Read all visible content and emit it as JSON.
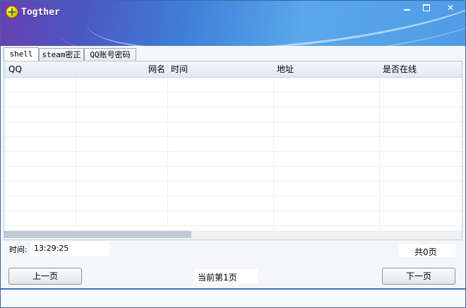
{
  "window": {
    "title": "Togther",
    "icon": "app-plus-icon"
  },
  "tabs": [
    {
      "label": "shell",
      "active": true
    },
    {
      "label": "steam密正",
      "active": false
    },
    {
      "label": "QQ账号密码",
      "active": false
    }
  ],
  "table": {
    "columns": [
      "QQ",
      "网名",
      "时间",
      "地址",
      "是否在线"
    ],
    "rows": []
  },
  "footer": {
    "time_label": "时间:",
    "time_value": "13:29:25",
    "total_pages": "共0页",
    "current_page": "当前第1页",
    "prev_button": "上一页",
    "next_button": "下一页"
  }
}
